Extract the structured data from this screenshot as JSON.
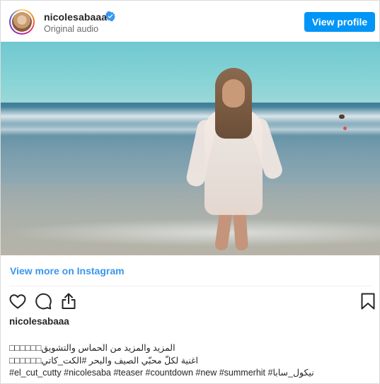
{
  "header": {
    "username": "nicolesabaaa",
    "audio_label": "Original audio",
    "view_profile_label": "View profile"
  },
  "media": {
    "view_more_label": "View more on Instagram"
  },
  "post": {
    "username": "nicolesabaaa",
    "caption_lines": [
      "□□□□□□المزيد والمزيد من الحماس والتشويق",
      "□□□□□□اغنية لكلّ محبّي الصيف والبحر #الكت_كاتي",
      "#el_cut_cutty #nicolesaba #teaser #countdown #new #summerhit #نيكول_سابا"
    ]
  },
  "icons": {
    "verified": "verified-badge-icon",
    "like": "heart-icon",
    "comment": "comment-icon",
    "share": "share-icon",
    "save": "bookmark-icon"
  },
  "colors": {
    "accent": "#0095f6",
    "link": "#3897f0",
    "text": "#262626",
    "muted": "#6b6b6b"
  }
}
